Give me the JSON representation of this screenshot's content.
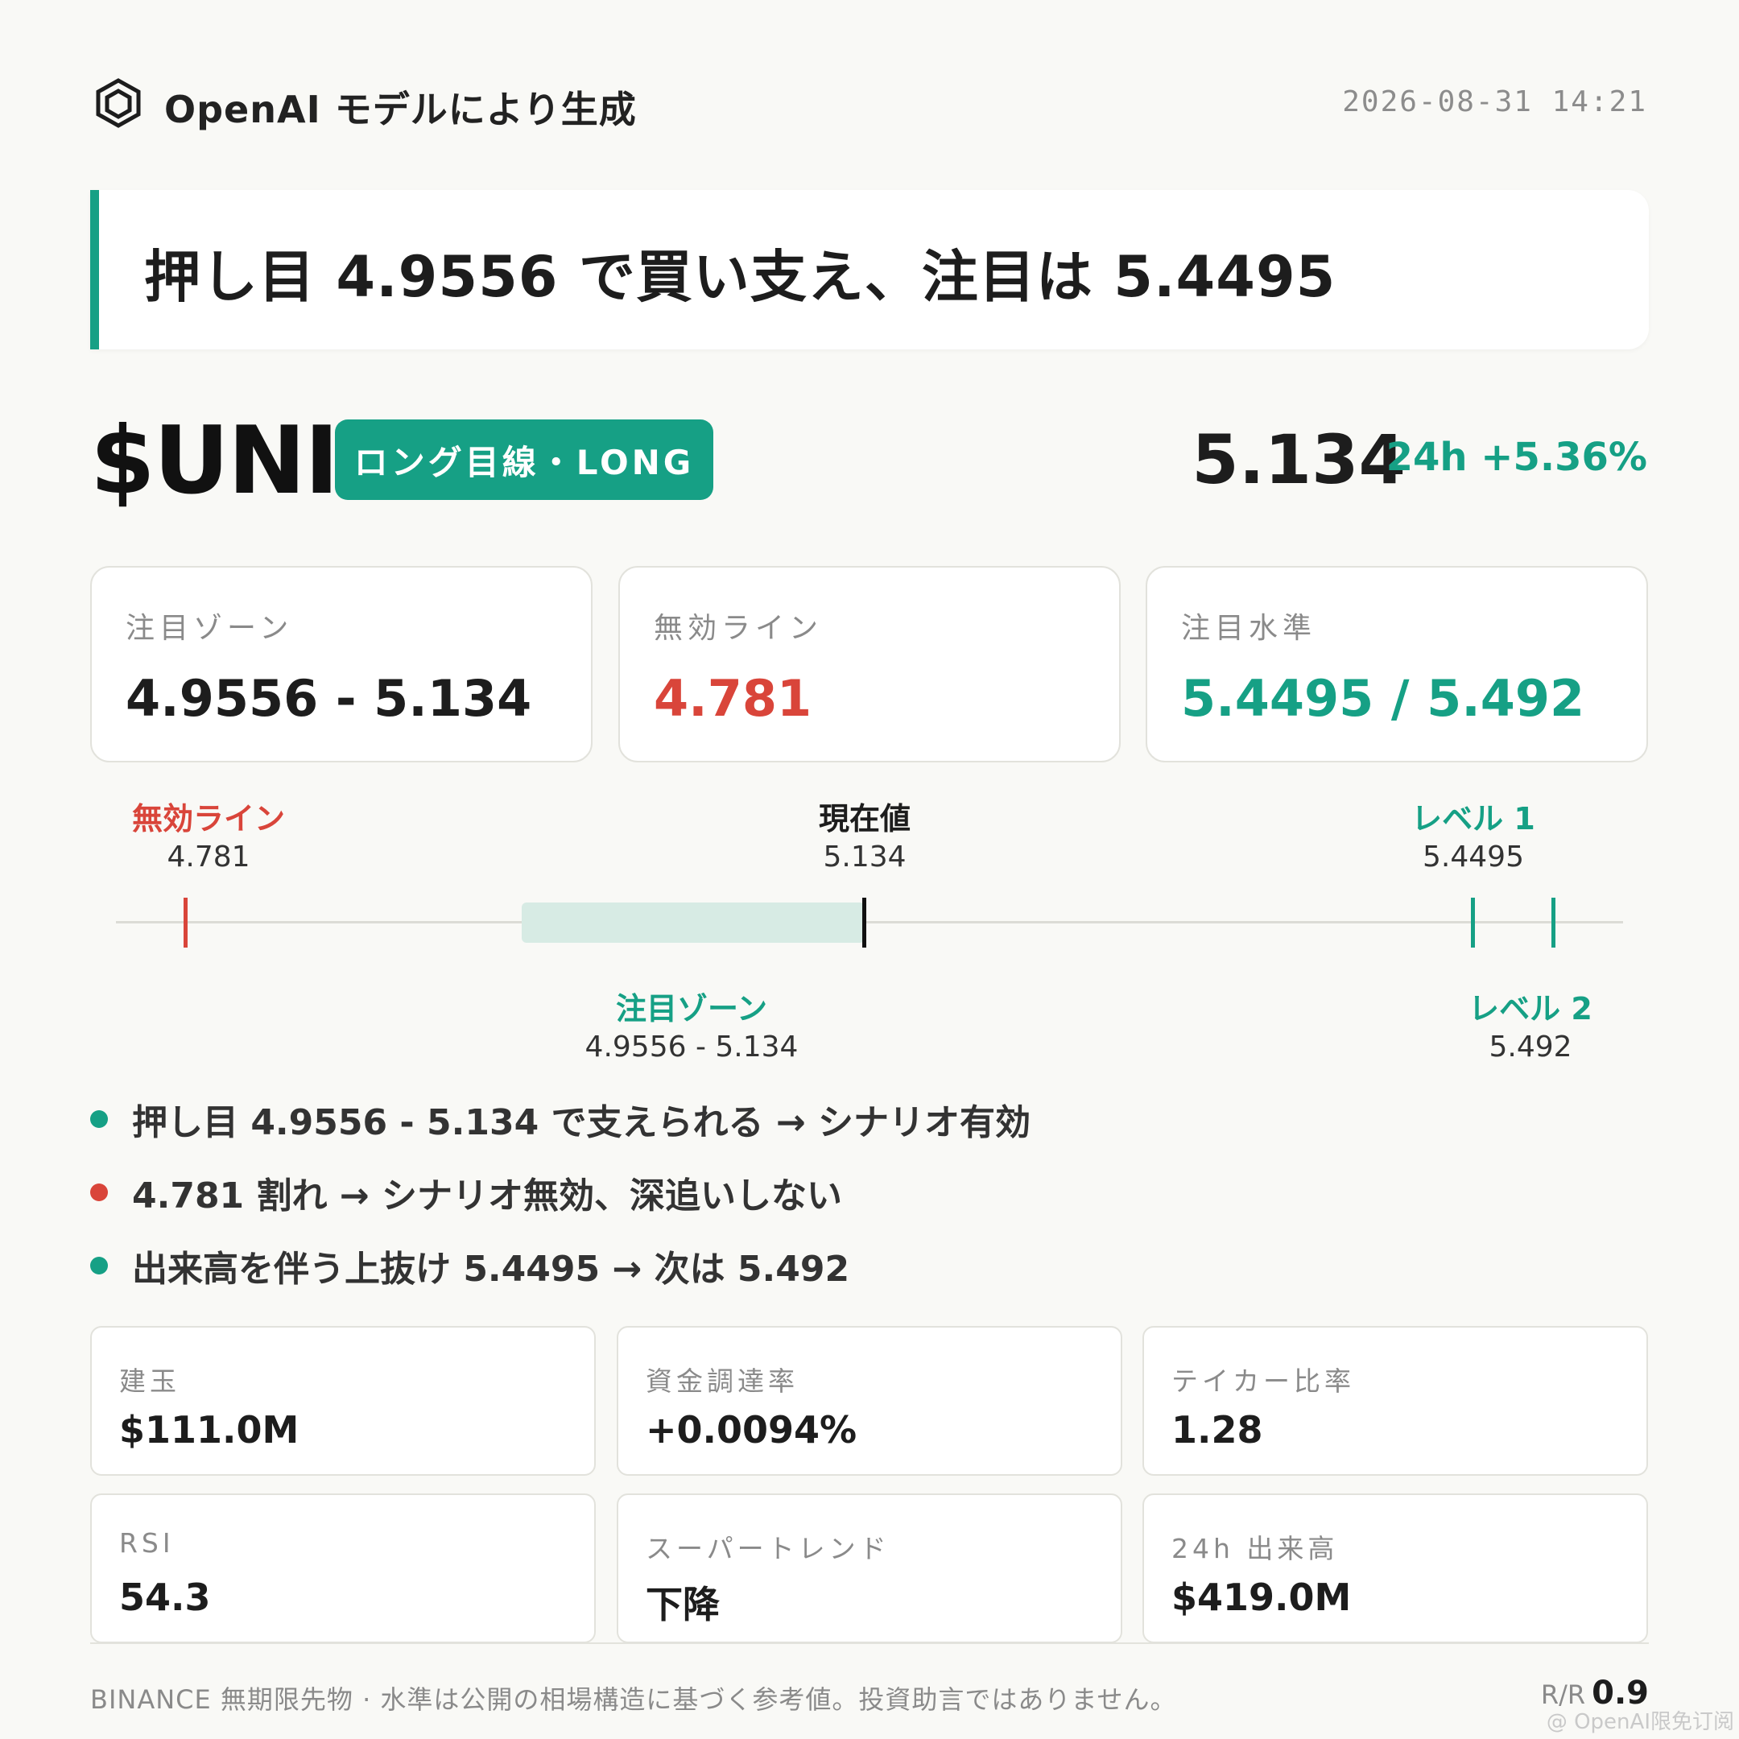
{
  "header": {
    "logo_icon": "openai-hexagon-icon",
    "brand": "OpenAI モデルにより生成",
    "timestamp": "2026-08-31 14:21"
  },
  "headline": "押し目 4.9556 で買い支え、注目は 5.4495",
  "symbol": "$UNI",
  "badge": "ロング目線・LONG",
  "price": "5.134",
  "change": "24h +5.36%",
  "colors": {
    "accent": "#16a085",
    "danger": "#d9453a",
    "text": "#1d1d1d",
    "muted": "#8a8a8a"
  },
  "levels": [
    {
      "label": "注目ゾーン",
      "value": "4.9556 - 5.134"
    },
    {
      "label": "無効ライン",
      "value": "4.781"
    },
    {
      "label": "注目水準",
      "value": "5.4495 / 5.492"
    }
  ],
  "ladder": {
    "invalid": {
      "label": "無効ライン",
      "value": "4.781"
    },
    "current": {
      "label": "現在値",
      "value": "5.134"
    },
    "zone": {
      "label": "注目ゾーン",
      "value": "4.9556 - 5.134"
    },
    "level1": {
      "label": "レベル 1",
      "value": "5.4495"
    },
    "level2": {
      "label": "レベル 2",
      "value": "5.492"
    }
  },
  "bullets": [
    "押し目 4.9556 - 5.134 で支えられる → シナリオ有効",
    "4.781 割れ → シナリオ無効、深追いしない",
    "出来高を伴う上抜け 5.4495 → 次は 5.492"
  ],
  "metrics": [
    {
      "label": "建玉",
      "value": "$111.0M"
    },
    {
      "label": "資金調達率",
      "value": "+0.0094%"
    },
    {
      "label": "テイカー比率",
      "value": "1.28"
    },
    {
      "label": "RSI",
      "value": "54.3"
    },
    {
      "label": "スーパートレンド",
      "value": "下降"
    },
    {
      "label": "24h 出来高",
      "value": "$419.0M"
    }
  ],
  "footer": {
    "disclaimer": "BINANCE 無期限先物 · 水準は公開の相場構造に基づく参考値。投資助言ではありません。",
    "rr_label": "R/R",
    "rr_value": "0.9",
    "watermark": "@ OpenAI限免订阅"
  }
}
